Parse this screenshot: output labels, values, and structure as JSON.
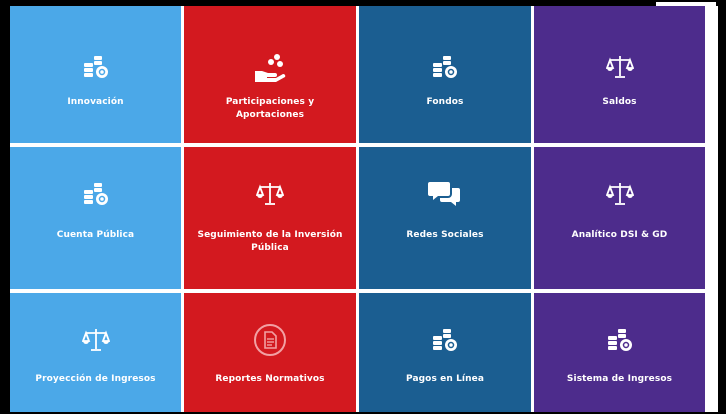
{
  "colors": {
    "light_blue": "#4ba8e8",
    "red": "#d3191f",
    "navy": "#1b5e91",
    "purple": "#4d2c8c"
  },
  "tiles": [
    {
      "label": "Innovación",
      "icon": "coins-icon",
      "color": "light_blue"
    },
    {
      "label": "Participaciones y Aportaciones",
      "icon": "hand-coins-icon",
      "color": "red"
    },
    {
      "label": "Fondos",
      "icon": "coins-icon",
      "color": "navy"
    },
    {
      "label": "Saldos",
      "icon": "balance-scale-icon",
      "color": "purple"
    },
    {
      "label": "Cuenta Pública",
      "icon": "coins-icon",
      "color": "light_blue"
    },
    {
      "label": "Seguimiento de la Inversión Pública",
      "icon": "balance-scale-icon",
      "color": "red"
    },
    {
      "label": "Redes Sociales",
      "icon": "chat-bubbles-icon",
      "color": "navy"
    },
    {
      "label": "Analítico DSI & GD",
      "icon": "balance-scale-icon",
      "color": "purple"
    },
    {
      "label": "Proyección de Ingresos",
      "icon": "balance-scale-icon",
      "color": "light_blue"
    },
    {
      "label": "Reportes Normativos",
      "icon": "document-circle-icon",
      "color": "red"
    },
    {
      "label": "Pagos en Línea",
      "icon": "coins-icon",
      "color": "navy"
    },
    {
      "label": "Sistema de Ingresos",
      "icon": "coins-icon",
      "color": "purple"
    }
  ]
}
